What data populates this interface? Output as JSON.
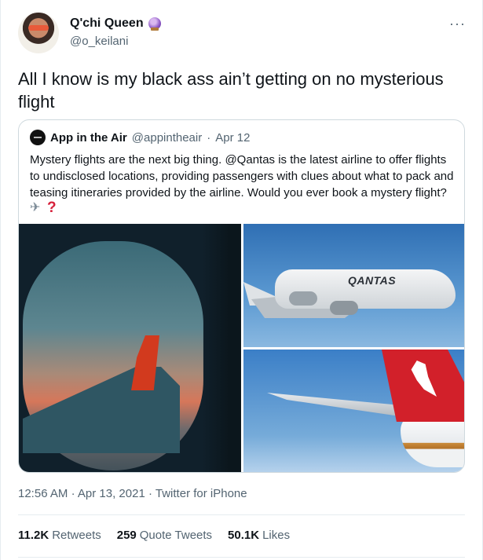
{
  "author": {
    "display_name": "Q'chi Queen",
    "handle": "@o_keilani",
    "badge_icon": "crystal-ball-icon",
    "more_icon": "more-dots-icon",
    "more_glyph": "···"
  },
  "tweet": {
    "text": "All I know is my black ass ain’t getting on no mysterious flight"
  },
  "quoted": {
    "display_name": "App in the Air",
    "handle": "@appintheair",
    "separator": "·",
    "date": "Apr 12",
    "text": "Mystery flights are the next big thing. @Qantas is the latest airline to offer flights to undisclosed locations, providing passengers with clues about what to pack and teasing itineraries provided by the airline. Would you ever book a mystery flight?",
    "emoji_icons": [
      "airplane-icon",
      "red-question-mark-icon"
    ],
    "question_glyph": "?",
    "images": [
      {
        "description_icon": "plane-window-photo"
      },
      {
        "description_icon": "a380-in-flight-photo",
        "livery_text": "QANTAS"
      },
      {
        "description_icon": "qantas-tail-fin-photo"
      }
    ]
  },
  "meta": {
    "time": "12:56 AM",
    "separator1": "·",
    "date": "Apr 13, 2021",
    "separator2": "·",
    "source": "Twitter for iPhone"
  },
  "stats": {
    "retweets_count": "11.2K",
    "retweets_label": "Retweets",
    "quotes_count": "259",
    "quotes_label": "Quote Tweets",
    "likes_count": "50.1K",
    "likes_label": "Likes"
  },
  "colors": {
    "text_primary": "#0f1419",
    "text_secondary": "#536471",
    "border": "#cfd9de",
    "qantas_red": "#d2202a"
  }
}
